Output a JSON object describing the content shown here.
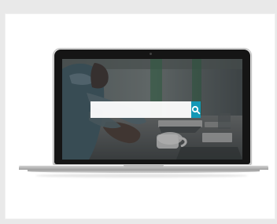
{
  "search": {
    "placeholder": "",
    "value": ""
  },
  "icons": {
    "search_button": "search-icon"
  },
  "colors": {
    "page_background": "#e9e9e9",
    "card_background": "#ffffff",
    "search_button": "#1498b6",
    "laptop_silver": "#d0d0d0",
    "screen_bezel": "#151515"
  }
}
